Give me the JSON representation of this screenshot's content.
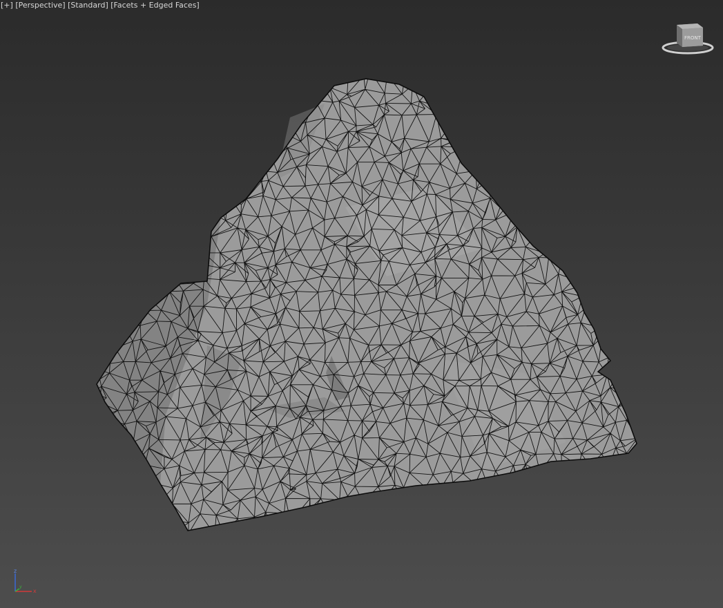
{
  "viewport": {
    "labels": [
      "[+]",
      "[Perspective]",
      "[Standard]",
      "[Facets + Edged Faces]"
    ],
    "viewcube_face": "FRONT",
    "axis_labels": {
      "x": "x",
      "y": "y",
      "z": "z"
    },
    "colors": {
      "mesh_fill": "#9b9b9b",
      "mesh_edge": "#111111",
      "axis_x": "#d23a3a",
      "axis_y": "#3ab33a",
      "axis_z": "#3a6ad8"
    }
  }
}
